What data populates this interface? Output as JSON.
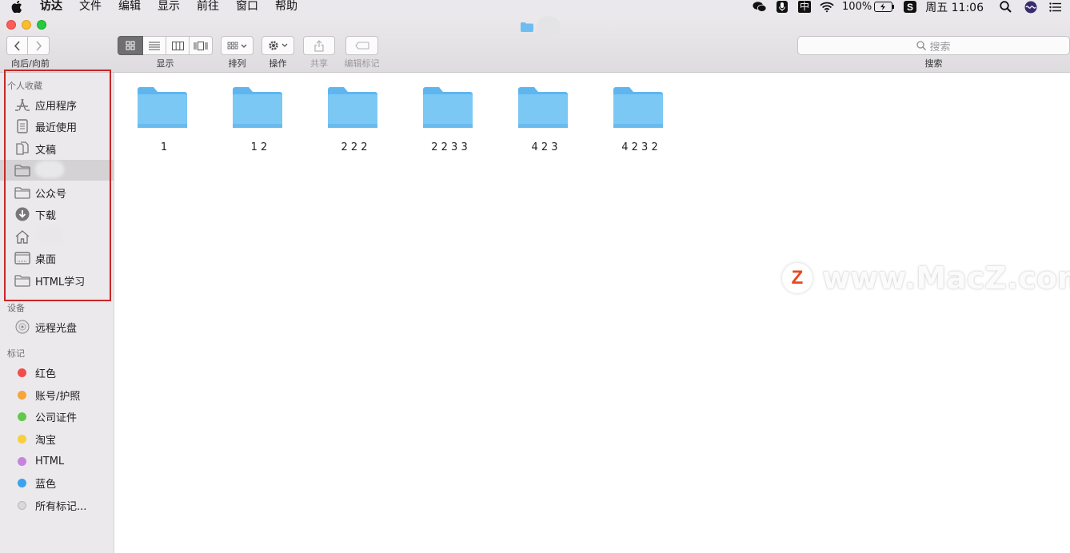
{
  "menubar": {
    "items": [
      "访达",
      "文件",
      "编辑",
      "显示",
      "前往",
      "窗口",
      "帮助"
    ],
    "battery": "100%",
    "datetime": "周五 11:06",
    "input_method": "中"
  },
  "toolbar": {
    "nav_label": "向后/向前",
    "view_label": "显示",
    "arrange_label": "排列",
    "action_label": "操作",
    "share_label": "共享",
    "tags_label": "编辑标记",
    "search_placeholder": "搜索",
    "search_label": "搜索"
  },
  "sidebar": {
    "favorites_title": "个人收藏",
    "favorites": [
      {
        "label": "应用程序",
        "icon": "applications-icon"
      },
      {
        "label": "最近使用",
        "icon": "recents-icon"
      },
      {
        "label": "文稿",
        "icon": "documents-icon"
      },
      {
        "label": "",
        "icon": "folder-icon"
      },
      {
        "label": "公众号",
        "icon": "folder-icon"
      },
      {
        "label": "下载",
        "icon": "downloads-icon"
      },
      {
        "label": "",
        "icon": "home-icon"
      },
      {
        "label": "桌面",
        "icon": "desktop-icon"
      },
      {
        "label": "HTML学习",
        "icon": "folder-icon"
      }
    ],
    "devices_title": "设备",
    "devices": [
      {
        "label": "远程光盘",
        "icon": "disc-icon"
      }
    ],
    "tags_title": "标记",
    "tags": [
      {
        "label": "红色",
        "color": "#f04e4a"
      },
      {
        "label": "账号/护照",
        "color": "#f7a43a"
      },
      {
        "label": "公司证件",
        "color": "#63c84a"
      },
      {
        "label": "淘宝",
        "color": "#f8cf3d"
      },
      {
        "label": "HTML",
        "color": "#c684e0"
      },
      {
        "label": "蓝色",
        "color": "#3aa3ee"
      },
      {
        "label": "所有标记...",
        "color": "#d9d8da"
      }
    ]
  },
  "folders": [
    "1",
    "1 2",
    "2 2 2",
    "2 2 3 3",
    "4 2 3",
    "4 2 3 2"
  ],
  "watermark": {
    "text": "www.MacZ.com",
    "logo": "Z"
  },
  "colors": {
    "folder": "#7cc8f5",
    "highlight": "#c62828"
  }
}
